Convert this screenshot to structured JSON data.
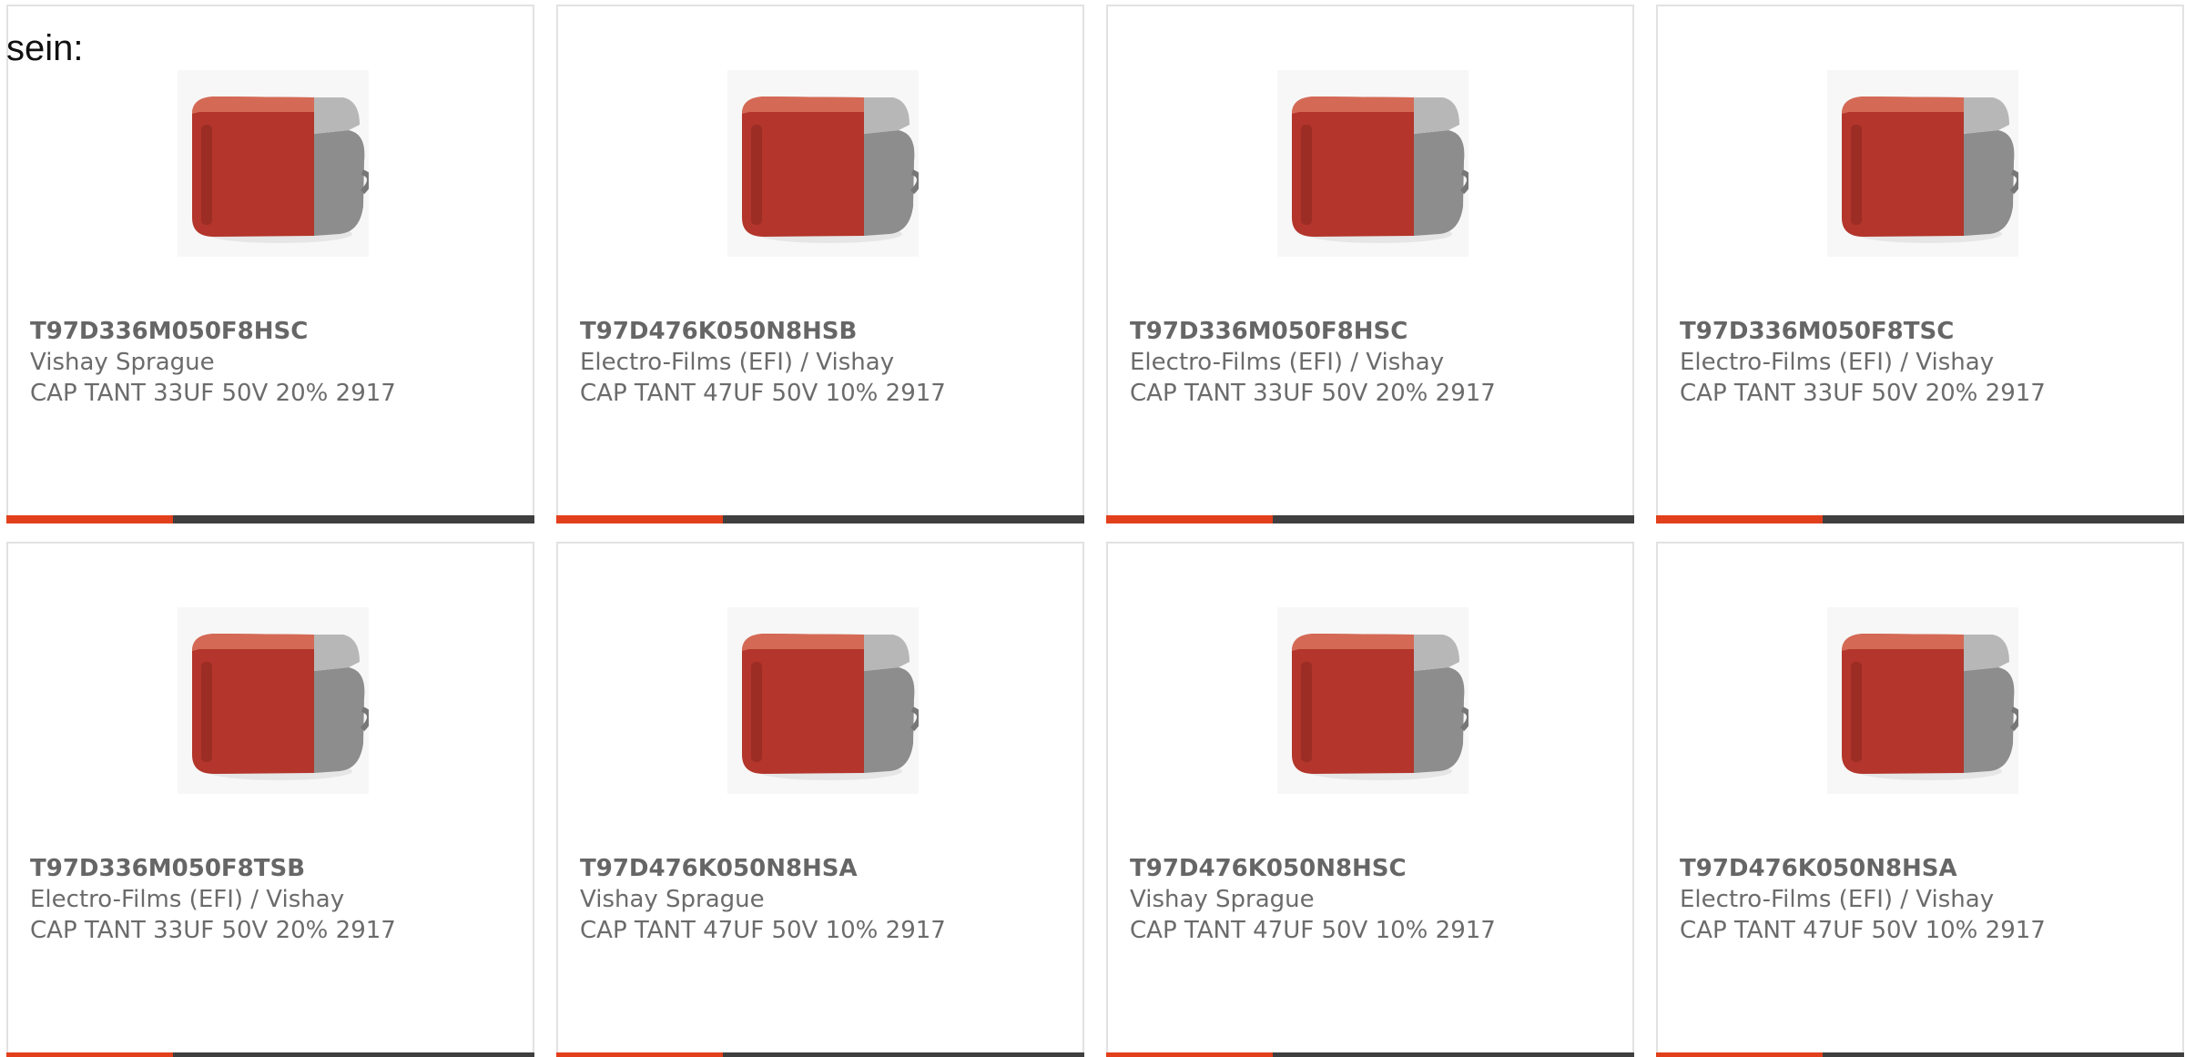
{
  "intro_text": "sein:",
  "colors": {
    "accent": "#e2401c",
    "bar": "#3f3f3f",
    "capacitor_body": "#b3352b",
    "capacitor_terminal": "#8d8d8d"
  },
  "products": [
    {
      "part_number": "T97D336M050F8HSC",
      "manufacturer": "Vishay Sprague",
      "description": "CAP TANT 33UF 50V 20% 2917",
      "image_icon": "tantalum-capacitor-icon"
    },
    {
      "part_number": "T97D476K050N8HSB",
      "manufacturer": "Electro-Films (EFI) / Vishay",
      "description": "CAP TANT 47UF 50V 10% 2917",
      "image_icon": "tantalum-capacitor-icon"
    },
    {
      "part_number": "T97D336M050F8HSC",
      "manufacturer": "Electro-Films (EFI) / Vishay",
      "description": "CAP TANT 33UF 50V 20% 2917",
      "image_icon": "tantalum-capacitor-icon"
    },
    {
      "part_number": "T97D336M050F8TSC",
      "manufacturer": "Electro-Films (EFI) / Vishay",
      "description": "CAP TANT 33UF 50V 20% 2917",
      "image_icon": "tantalum-capacitor-icon"
    },
    {
      "part_number": "T97D336M050F8TSB",
      "manufacturer": "Electro-Films (EFI) / Vishay",
      "description": "CAP TANT 33UF 50V 20% 2917",
      "image_icon": "tantalum-capacitor-icon"
    },
    {
      "part_number": "T97D476K050N8HSA",
      "manufacturer": "Vishay Sprague",
      "description": "CAP TANT 47UF 50V 10% 2917",
      "image_icon": "tantalum-capacitor-icon"
    },
    {
      "part_number": "T97D476K050N8HSC",
      "manufacturer": "Vishay Sprague",
      "description": "CAP TANT 47UF 50V 10% 2917",
      "image_icon": "tantalum-capacitor-icon"
    },
    {
      "part_number": "T97D476K050N8HSA",
      "manufacturer": "Electro-Films (EFI) / Vishay",
      "description": "CAP TANT 47UF 50V 10% 2917",
      "image_icon": "tantalum-capacitor-icon"
    }
  ]
}
